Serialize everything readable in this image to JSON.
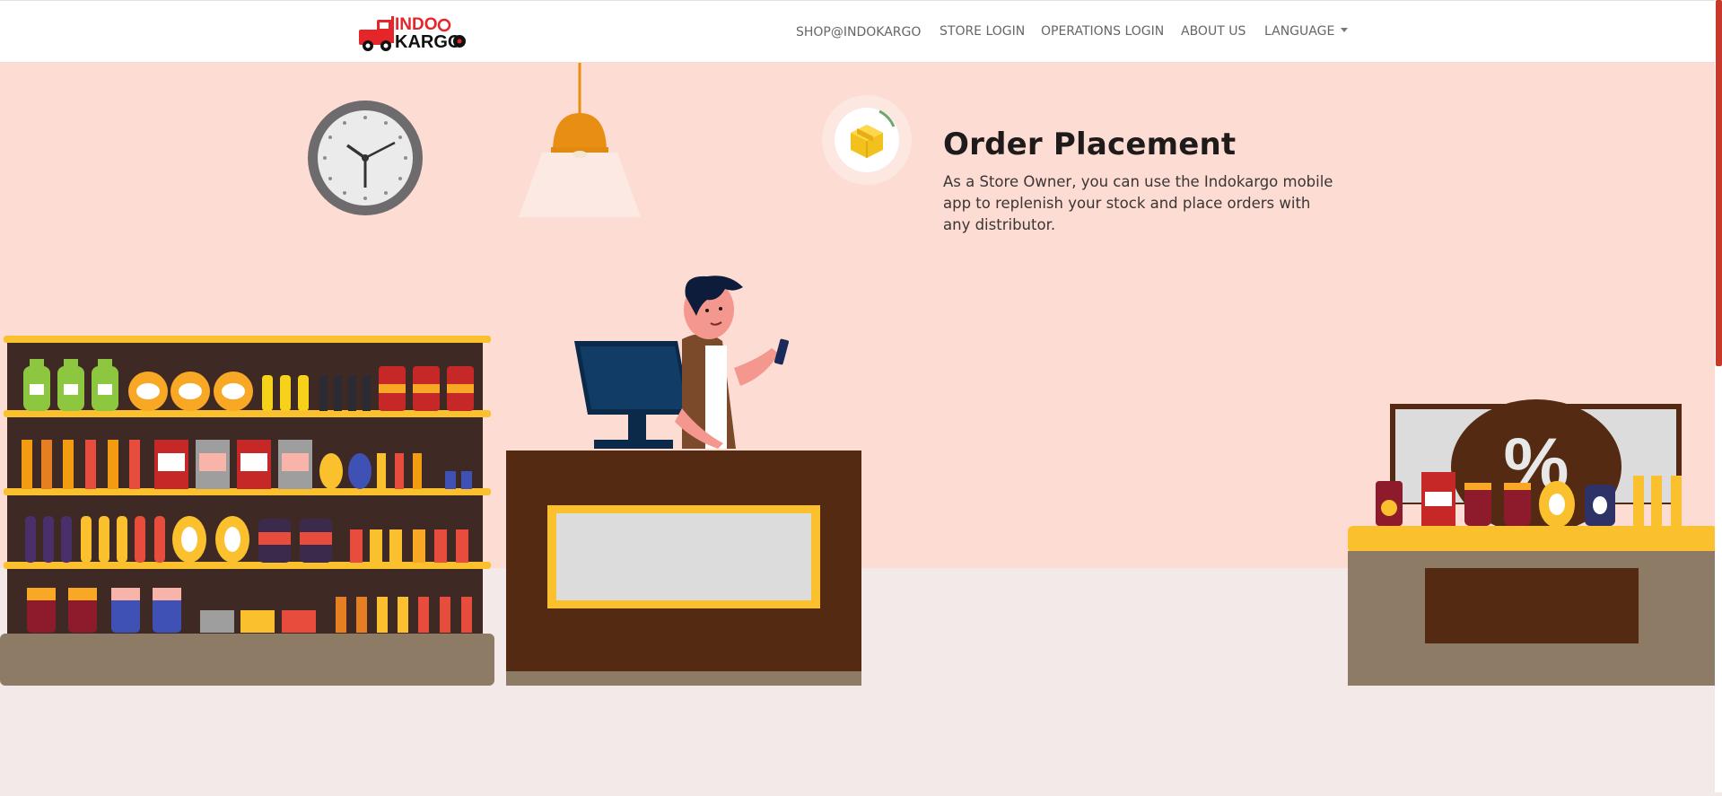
{
  "brand": {
    "logo_line1": "INDO",
    "logo_line2": "KARGO",
    "red": "#e4262b",
    "dark": "#111111"
  },
  "nav": {
    "items": [
      {
        "label": "SHOP@INDOKARGO"
      },
      {
        "label": "STORE LOGIN"
      },
      {
        "label": "OPERATIONS LOGIN"
      },
      {
        "label": "ABOUT US"
      },
      {
        "label": "LANGUAGE"
      }
    ]
  },
  "feature": {
    "title": "Order Placement",
    "description": "As a Store Owner, you can use the Indokargo mobile app to replenish your stock and place orders with any distributor.",
    "icon": "package-box-icon"
  },
  "scene": {
    "sale_sign": "%",
    "colors": {
      "wall": "#fddcd3",
      "floor": "#f3e9e8",
      "shelf": "#fbc02d",
      "wood": "#552a13",
      "base": "#8e7b65"
    }
  }
}
